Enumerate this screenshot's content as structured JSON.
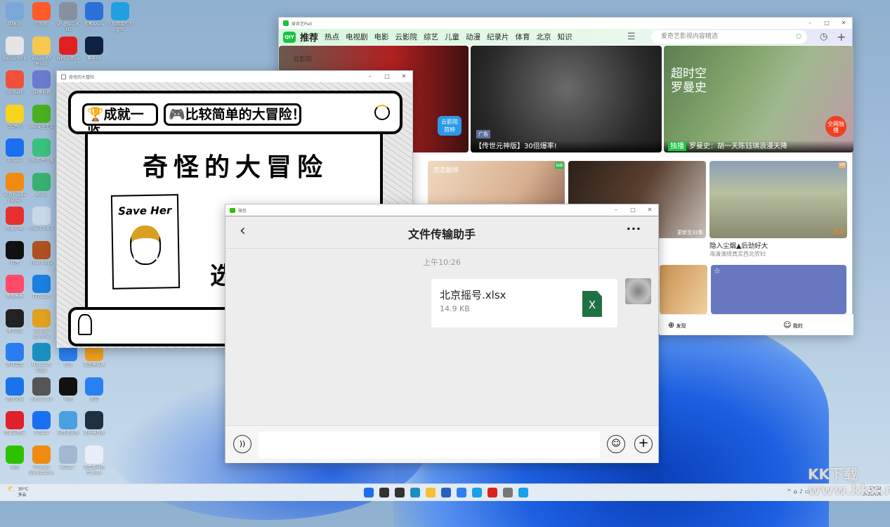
{
  "desktop_icons": [
    {
      "label": "回收站",
      "color": "#7aa7d8",
      "col": 0,
      "row": 0
    },
    {
      "label": "Axure RP 9",
      "color": "#e5e5e5",
      "col": 0,
      "row": 1
    },
    {
      "label": "Git Bash",
      "color": "#f0503c",
      "col": 0,
      "row": 2
    },
    {
      "label": "QQ音乐",
      "color": "#f6d420",
      "col": 0,
      "row": 3
    },
    {
      "label": "ToDesk",
      "color": "#1a6ff0",
      "col": 0,
      "row": 4
    },
    {
      "label": "VLC media player",
      "color": "#f08a10",
      "col": 0,
      "row": 5
    },
    {
      "label": "网易邮箱",
      "color": "#e83030",
      "col": 0,
      "row": 6
    },
    {
      "label": "抖音",
      "color": "#111111",
      "col": 0,
      "row": 7
    },
    {
      "label": "美图秀秀",
      "color": "#ff4a6a",
      "col": 0,
      "row": 8
    },
    {
      "label": "腾讯QQ",
      "color": "#222222",
      "col": 0,
      "row": 9
    },
    {
      "label": "腾讯会议",
      "color": "#2a7df0",
      "col": 0,
      "row": 10
    },
    {
      "label": "腾讯文档",
      "color": "#1a73e8",
      "col": 0,
      "row": 11
    },
    {
      "label": "网易云音乐",
      "color": "#e0202a",
      "col": 0,
      "row": 12
    },
    {
      "label": "微信",
      "color": "#2dc100",
      "col": 0,
      "row": 13
    },
    {
      "label": "闪电剪",
      "color": "#ff5a2a",
      "col": 1,
      "row": 0
    },
    {
      "label": "Axure RP Pro10",
      "color": "#f6c850",
      "col": 1,
      "row": 1
    },
    {
      "label": "3D模拟器",
      "color": "#6a7ad0",
      "col": 1,
      "row": 2
    },
    {
      "label": "360安全卫士",
      "color": "#4ab020",
      "col": 1,
      "row": 3
    },
    {
      "label": "360软件管家",
      "color": "#3ac080",
      "col": 1,
      "row": 4
    },
    {
      "label": "Atom",
      "color": "#3ab070",
      "col": 1,
      "row": 5
    },
    {
      "label": "Free Cam 8",
      "color": "#c8d8e8",
      "col": 1,
      "row": 6
    },
    {
      "label": "Fruit Ninja",
      "color": "#b05020",
      "col": 1,
      "row": 7
    },
    {
      "label": "FTPRush",
      "color": "#1a80e0",
      "col": 1,
      "row": 8
    },
    {
      "label": "Google Chrome",
      "color": "#e0a020",
      "col": 1,
      "row": 9
    },
    {
      "label": "Microsoft Edge",
      "color": "#1a90c0",
      "col": 1,
      "row": 10
    },
    {
      "label": "rufus-3.18",
      "color": "#555555",
      "col": 1,
      "row": 11
    },
    {
      "label": "ToDesk",
      "color": "#1a6ff0",
      "col": 1,
      "row": 12
    },
    {
      "label": "VMware Workstation",
      "color": "#f08a10",
      "col": 1,
      "row": 13
    },
    {
      "label": "VR虚拟山水3D",
      "color": "#8890a0",
      "col": 2,
      "row": 0
    },
    {
      "label": "WPS Office",
      "color": "#e02020",
      "col": 2,
      "row": 1
    },
    {
      "label": "钉钉",
      "color": "#2a80f0",
      "col": 2,
      "row": 10
    },
    {
      "label": "抖音",
      "color": "#111111",
      "col": 2,
      "row": 11
    },
    {
      "label": "视频播放器",
      "color": "#4aa0e0",
      "col": 2,
      "row": 12
    },
    {
      "label": "格式工厂",
      "color": "#a0b8d0",
      "col": 2,
      "row": 13
    },
    {
      "label": "蓝奏Azure",
      "color": "#2a70d8",
      "col": 3,
      "row": 0
    },
    {
      "label": "摹客RP",
      "color": "#102040",
      "col": 3,
      "row": 1
    },
    {
      "label": "逍遥模拟器",
      "color": "#f0a020",
      "col": 3,
      "row": 10
    },
    {
      "label": "迅雷",
      "color": "#2a80f0",
      "col": 3,
      "row": 11
    },
    {
      "label": "夜神模拟器",
      "color": "#203040",
      "col": 3,
      "row": 12
    },
    {
      "label": "北京摇号名单.docx",
      "color": "#e8eef8",
      "col": 3,
      "row": 13
    },
    {
      "label": "比较简单的大冒险",
      "color": "#20a0e0",
      "col": 4,
      "row": 0
    }
  ],
  "iqiyi": {
    "title": "爱奇艺Pad",
    "logo": "QIY",
    "nav": [
      "推荐",
      "热点",
      "电视剧",
      "电影",
      "云影院",
      "综艺",
      "儿童",
      "动漫",
      "纪录片",
      "体育",
      "北京",
      "知识"
    ],
    "search_placeholder": "爱奇艺影视内容精选",
    "banners": [
      {
        "badge": "云影院首映",
        "caption": "",
        "tag": "云影院"
      },
      {
        "badge": "广告",
        "caption": "【传世元神版】30倍爆率!"
      },
      {
        "badge": "独播",
        "caption": "罗曼史：胡一天陈钰琪浪漫天降",
        "poster": "超时空罗曼史",
        "corner": "全网独播"
      }
    ],
    "cards": [
      {
        "tag": "独播",
        "brand": "恋恋剧场",
        "episode": ""
      },
      {
        "tag": "",
        "episode": "更新至32集"
      },
      {
        "tag": "VIP",
        "title": "隐入尘烟▲后劲好大",
        "subtitle": "海清演绎真实西北农妇",
        "score": "9.6"
      }
    ],
    "bottom_tabs": [
      "发现",
      "我的"
    ]
  },
  "game": {
    "title": "奇怪的大冒险",
    "btn_achievements": "成就一览",
    "btn_mode": "比较简单的大冒险！",
    "game_title": "奇怪的大冒险",
    "poster_text": "Save Her",
    "partial_text": "选"
  },
  "wechat": {
    "window_title": "微信",
    "chat_title": "文件传输助手",
    "timestamp": "上午10:26",
    "file": {
      "name": "北京摇号.xlsx",
      "size": "14.9 KB",
      "icon_letter": "X"
    }
  },
  "taskbar": {
    "weather_temp": "30°C",
    "weather_desc": "多云",
    "time": "10:32",
    "date": "2022/9/6",
    "apps": [
      {
        "name": "start",
        "color": "#1a6ff0"
      },
      {
        "name": "search",
        "color": "#333"
      },
      {
        "name": "task-view",
        "color": "#333"
      },
      {
        "name": "edge",
        "color": "#1a90c0"
      },
      {
        "name": "explorer",
        "color": "#f6c030"
      },
      {
        "name": "store",
        "color": "#2a60c0"
      },
      {
        "name": "feishu",
        "color": "#2a80f0"
      },
      {
        "name": "tool",
        "color": "#1aa0e8"
      },
      {
        "name": "wps",
        "color": "#e02020"
      },
      {
        "name": "usb",
        "color": "#777"
      },
      {
        "name": "tool2",
        "color": "#1aa0e8"
      }
    ]
  },
  "watermark": "KK下载 www.kkx.net"
}
